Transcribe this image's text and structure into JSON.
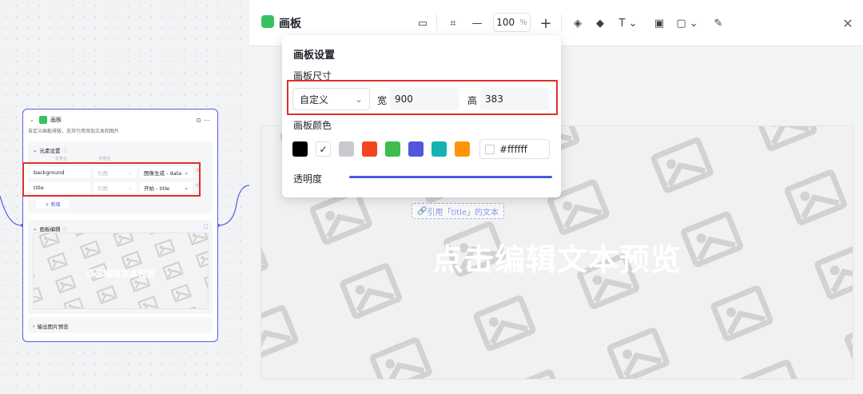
{
  "node": {
    "title": "画板",
    "description": "自定义画板排版，支持引用添加文本和图片",
    "elements_section": "元素设置",
    "col_name": "变量名",
    "col_type": "变量值",
    "rows": [
      {
        "name": "background",
        "type": "引用",
        "value": "图像生成 - data"
      },
      {
        "name": "title",
        "type": "引用",
        "value": "开始 - title"
      }
    ],
    "add_label": "+ 新增",
    "canvas_section": "画板编辑",
    "mini_preview_text": "点击编辑文本预览",
    "output_section": "输出图片预览"
  },
  "editor": {
    "title": "画板",
    "zoom": "100",
    "zoom_unit": "%",
    "preview_text": "点击编辑文本预览",
    "ref_text": "引用「title」的文本"
  },
  "popup": {
    "title": "画板设置",
    "size_label": "画板尺寸",
    "size_mode": "自定义",
    "width_label": "宽",
    "width_value": "900",
    "height_label": "高",
    "height_value": "383",
    "color_label": "画板颜色",
    "colors": [
      "#000000",
      "#ffffff",
      "#c8c9cc",
      "#f5451f",
      "#3cbd4c",
      "#4f57e0",
      "#16b2b0",
      "#ff9408"
    ],
    "color_hex": "#ffffff",
    "opacity_label": "透明度",
    "accent": "#4a58e6"
  }
}
